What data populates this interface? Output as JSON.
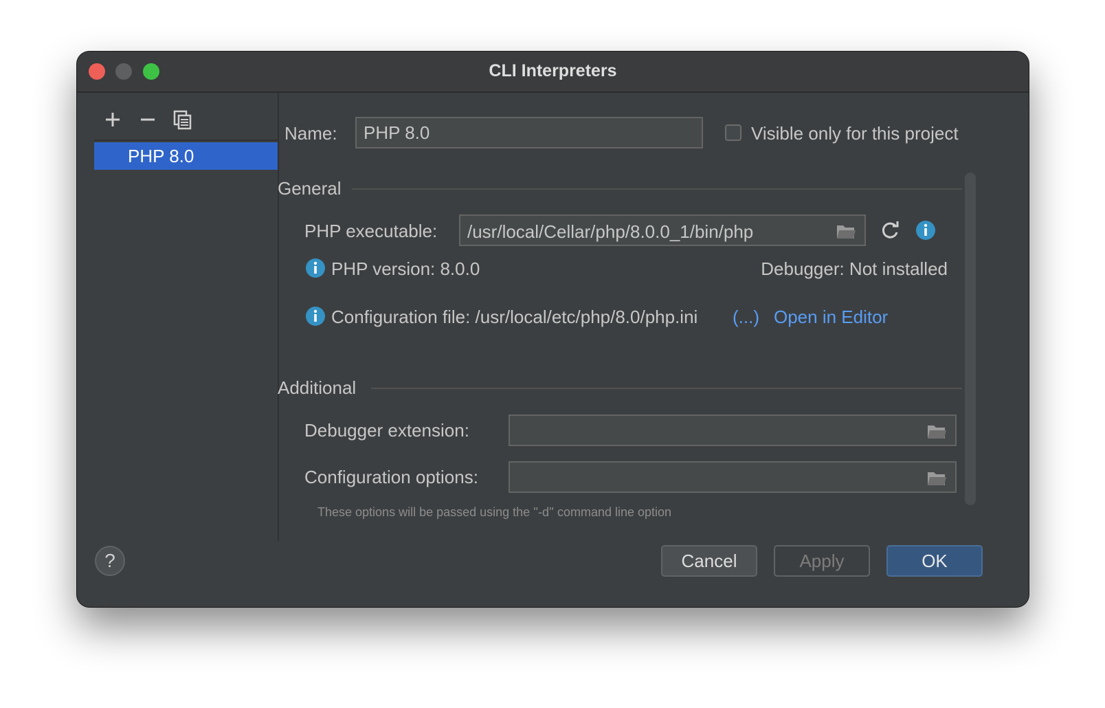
{
  "window": {
    "title": "CLI Interpreters"
  },
  "toolbar": {
    "add_icon": "plus-icon",
    "remove_icon": "minus-icon",
    "copy_icon": "copy-icon"
  },
  "interpreters": [
    {
      "label": "PHP 8.0",
      "selected": true
    }
  ],
  "name_field": {
    "label": "Name:",
    "value": "PHP 8.0"
  },
  "visible_only": {
    "label": "Visible only for this project",
    "checked": false
  },
  "general": {
    "heading": "General",
    "executable_label": "PHP executable:",
    "executable_value": "/usr/local/Cellar/php/8.0.0_1/bin/php",
    "version_text": "PHP version: 8.0.0",
    "debugger_text": "Debugger: Not installed",
    "config_file_text": "Configuration file: /usr/local/etc/php/8.0/php.ini",
    "config_more_link": "(...)",
    "open_in_editor_link": "Open in Editor"
  },
  "additional": {
    "heading": "Additional",
    "debugger_extension_label": "Debugger extension:",
    "debugger_extension_value": "",
    "config_options_label": "Configuration options:",
    "config_options_value": "",
    "hint": "These options will be passed using the ''-d'' command line option"
  },
  "buttons": {
    "help": "?",
    "cancel": "Cancel",
    "apply": "Apply",
    "ok": "OK"
  },
  "colors": {
    "accent": "#2f65ca",
    "link": "#589df6",
    "info": "#3592c4",
    "ok_button": "#365880"
  }
}
